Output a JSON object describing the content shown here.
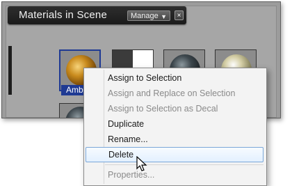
{
  "panel": {
    "title": "Materials in Scene",
    "manage_label": "Manage",
    "close_label": "×"
  },
  "swatches": [
    {
      "label": "Amber",
      "selected": true
    },
    {
      "label": "",
      "selected": false
    },
    {
      "label": "",
      "selected": false
    },
    {
      "label": "",
      "selected": false
    }
  ],
  "context_menu": {
    "items": [
      {
        "label": "Assign to Selection",
        "enabled": true
      },
      {
        "label": "Assign and Replace on Selection",
        "enabled": false
      },
      {
        "label": "Assign to Selection as Decal",
        "enabled": false
      },
      {
        "label": "Duplicate",
        "enabled": true
      },
      {
        "label": "Rename...",
        "enabled": true
      },
      {
        "label": "Delete",
        "enabled": true,
        "hovered": true
      },
      {
        "label": "Properties...",
        "enabled": false
      }
    ]
  },
  "colors": {
    "selection_blue": "#1f3a93",
    "hover_border": "#7aa7d8"
  }
}
